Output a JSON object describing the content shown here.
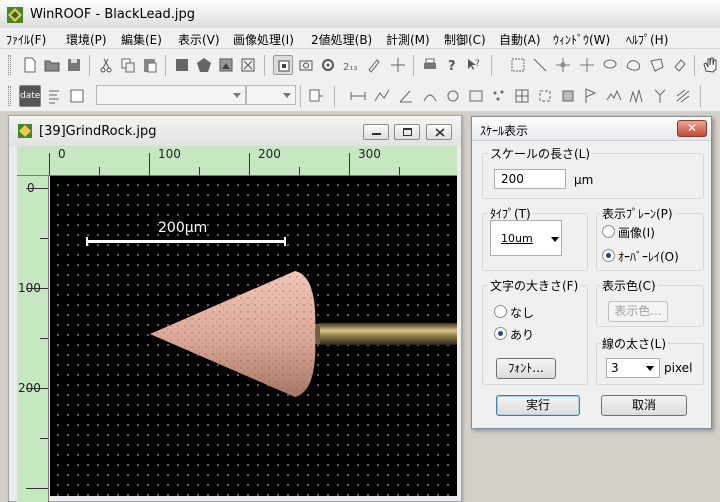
{
  "app": {
    "title": "WinROOF - BlackLead.jpg"
  },
  "menu": [
    "ﾌｧｲﾙ(F)",
    "環境(P)",
    "編集(E)",
    "表示(V)",
    "画像処理(I)",
    "2値処理(B)",
    "計測(M)",
    "制御(C)",
    "自動(A)",
    "ｳｨﾝﾄﾞｳ(W)",
    "ﾍﾙﾌﾟ(H)"
  ],
  "toolbar": {
    "date_label": "date"
  },
  "child": {
    "title": "[39]GrindRock.jpg",
    "ruler_x": [
      "0",
      "100",
      "200",
      "300"
    ],
    "ruler_y": [
      "0",
      "100",
      "200"
    ],
    "scale_text": "200μm"
  },
  "dialog": {
    "title": "ｽｹｰﾙ表示",
    "close_label": "✕",
    "scale_length_label": "スケールの長さ(L)",
    "scale_length_value": "200",
    "unit": "μm",
    "type_label": "ﾀｲﾌﾟ(T)",
    "type_preview_text": "10um",
    "plane_label": "表示ﾌﾟﾚｰﾝ(P)",
    "plane_options": [
      "画像(I)",
      "ｵｰﾊﾞｰﾚｲ(O)"
    ],
    "plane_selected": "ｵｰﾊﾞｰﾚｲ(O)",
    "text_size_label": "文字の大きさ(F)",
    "text_size_options": [
      "なし",
      "あり"
    ],
    "text_size_selected": "あり",
    "font_button": "ﾌｫﾝﾄ...",
    "color_label": "表示色(C)",
    "color_button": "表示色...",
    "line_width_label": "線の太さ(L)",
    "line_width_value": "3",
    "line_width_unit": "pixel",
    "run_button": "実行",
    "cancel_button": "取消"
  },
  "colors": {
    "ruler": "#c5e8c1",
    "viewport": "#000000",
    "cone": "#e7b7a8",
    "rod": "#b39a5a",
    "dialog_close": "#c74a34"
  }
}
